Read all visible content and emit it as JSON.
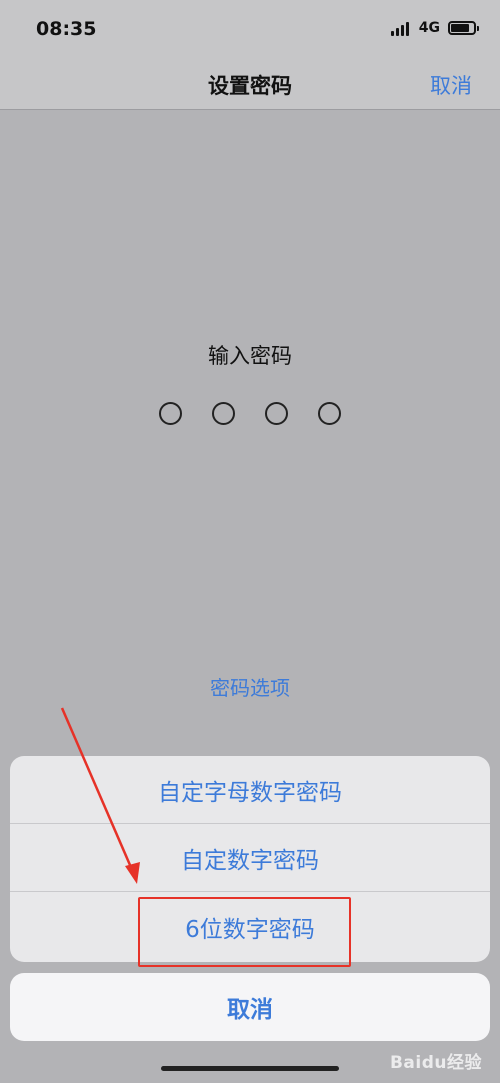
{
  "status_bar": {
    "time": "08:35",
    "network": "4G",
    "battery_level": 0.8
  },
  "nav": {
    "title": "设置密码",
    "cancel_label": "取消"
  },
  "passcode": {
    "prompt": "输入密码",
    "digits_total": 4,
    "digits_entered": 0
  },
  "options_link": "密码选项",
  "action_sheet": {
    "items": [
      {
        "label": "自定字母数字密码"
      },
      {
        "label": "自定数字密码"
      },
      {
        "label": "6位数字密码"
      }
    ],
    "cancel_label": "取消"
  },
  "annotation": {
    "highlight_color": "#e63228",
    "highlighted_item": "6位数字密码"
  },
  "colors": {
    "accent": "#3d7bd9",
    "background": "#b3b3b6"
  },
  "watermark": "Baidu经验"
}
